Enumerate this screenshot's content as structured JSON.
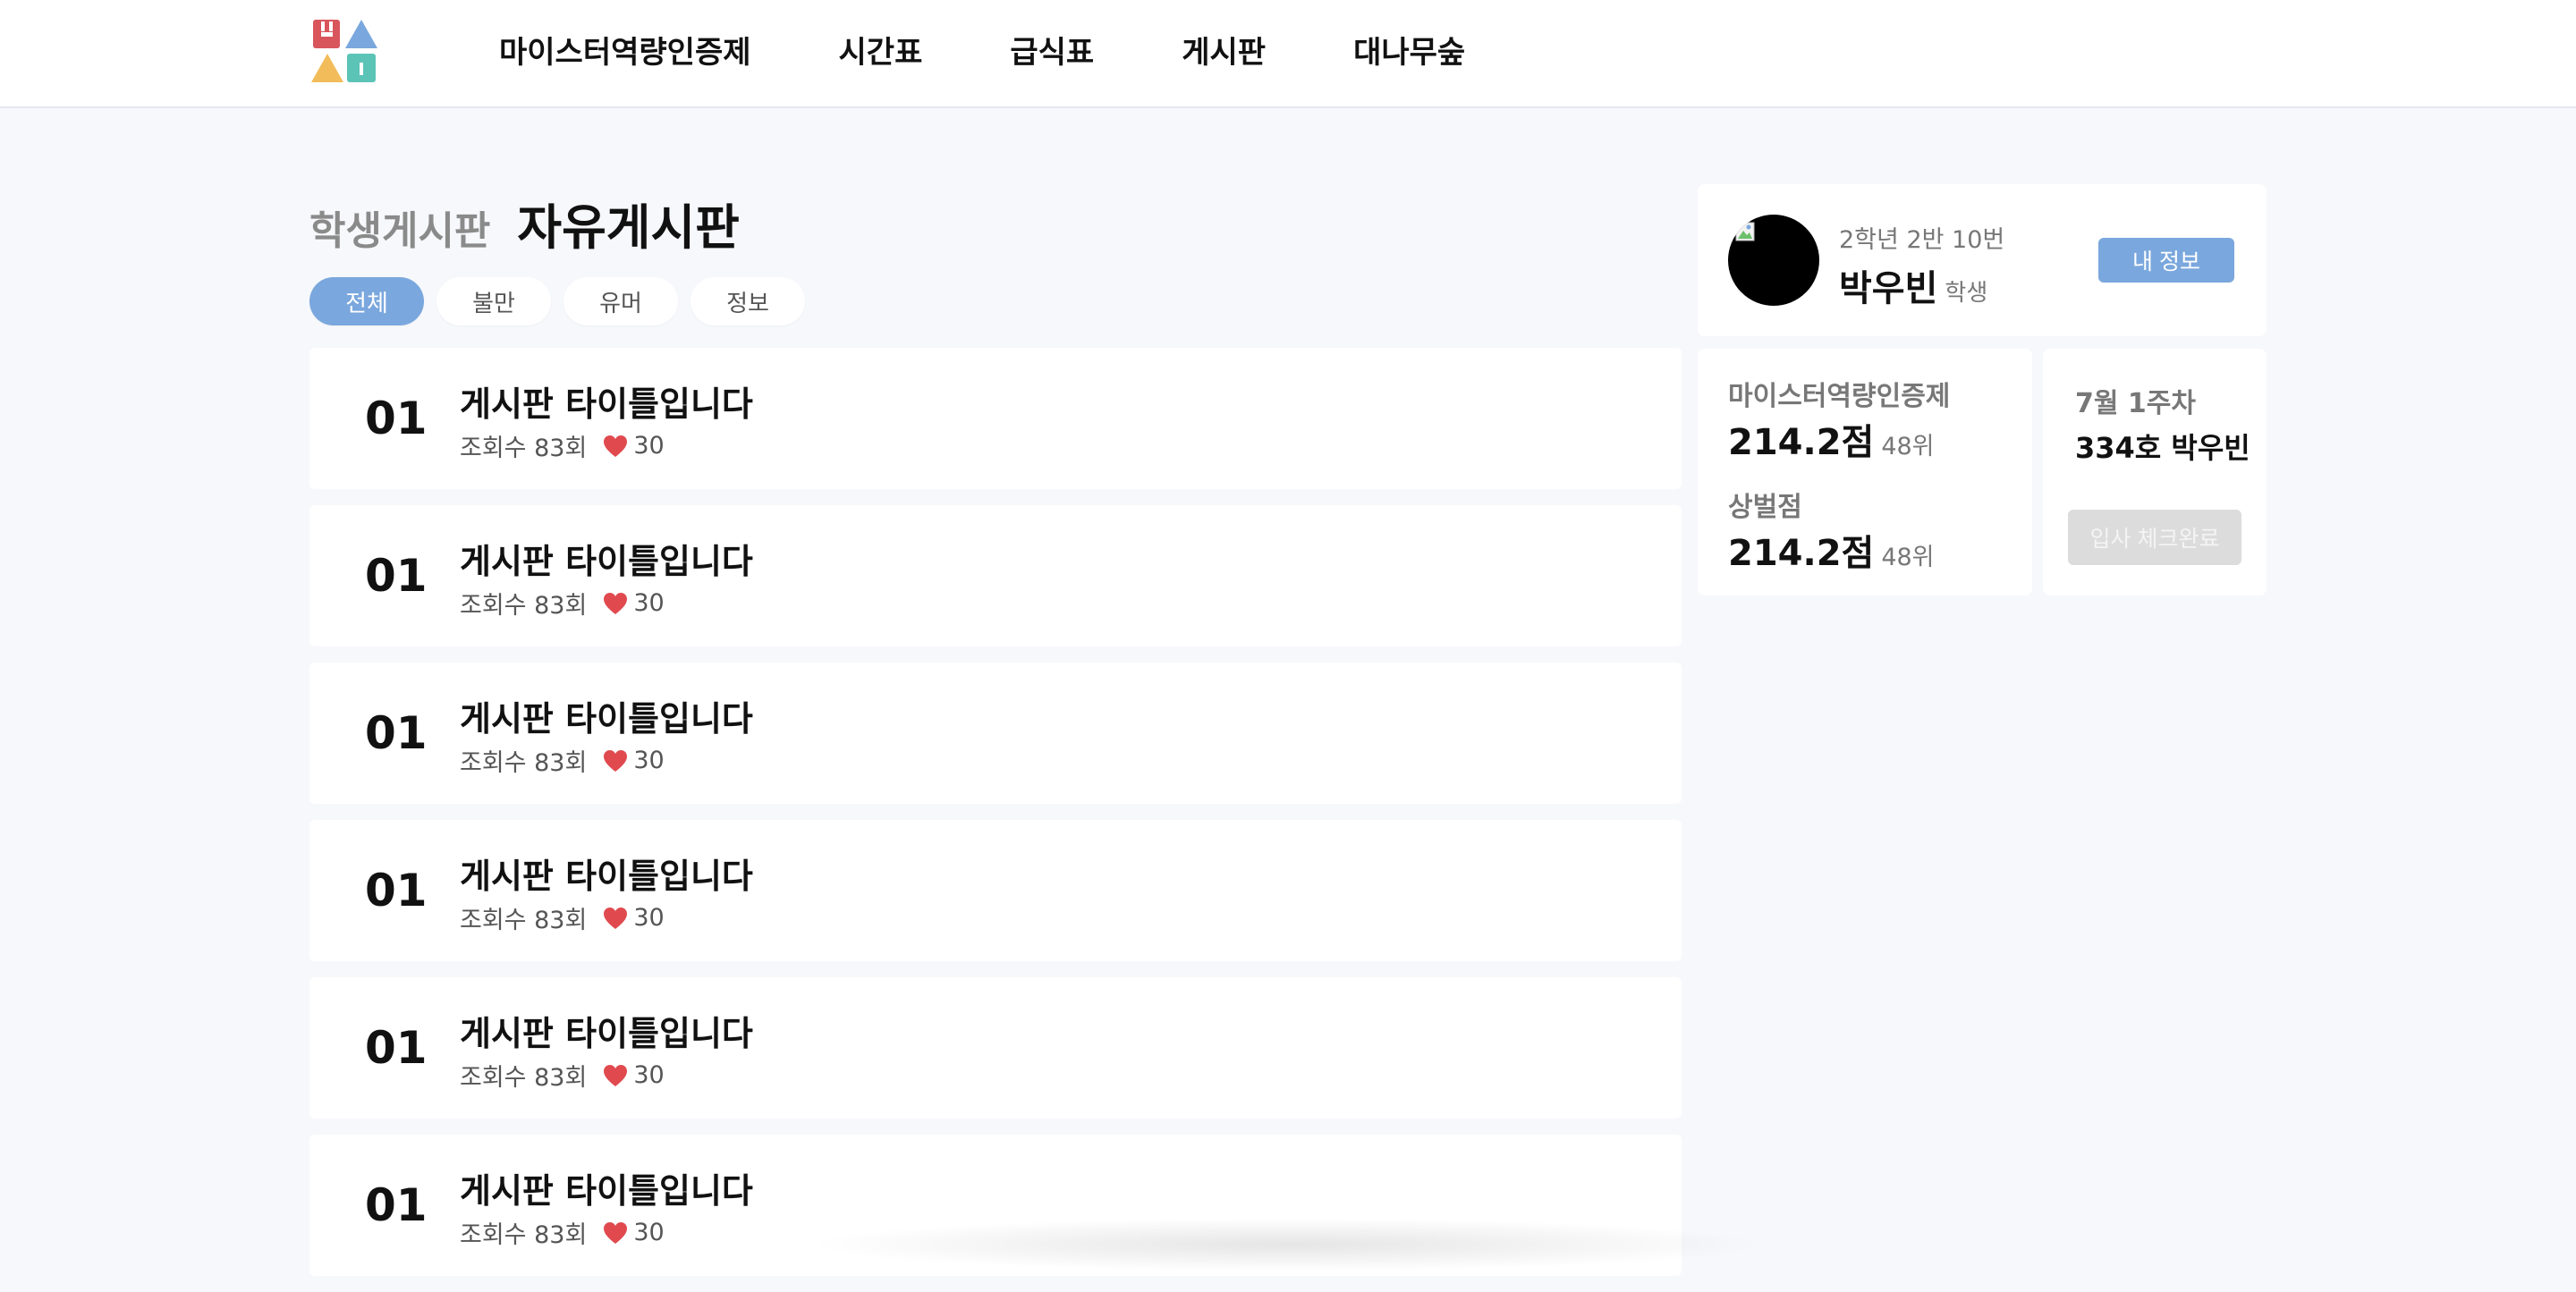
{
  "header": {
    "logo_icon": "house-blocks-icon",
    "nav": [
      {
        "label": "마이스터역량인증제"
      },
      {
        "label": "시간표"
      },
      {
        "label": "급식표"
      },
      {
        "label": "게시판"
      },
      {
        "label": "대나무숲"
      }
    ]
  },
  "board": {
    "parent": "학생게시판",
    "name": "자유게시판"
  },
  "filters": [
    {
      "label": "전체",
      "active": true
    },
    {
      "label": "불만",
      "active": false
    },
    {
      "label": "유머",
      "active": false
    },
    {
      "label": "정보",
      "active": false
    }
  ],
  "posts": [
    {
      "num": "01",
      "title": "게시판 타이틀입니다",
      "views": "조회수 83회",
      "likes": "30"
    },
    {
      "num": "01",
      "title": "게시판 타이틀입니다",
      "views": "조회수 83회",
      "likes": "30"
    },
    {
      "num": "01",
      "title": "게시판 타이틀입니다",
      "views": "조회수 83회",
      "likes": "30"
    },
    {
      "num": "01",
      "title": "게시판 타이틀입니다",
      "views": "조회수 83회",
      "likes": "30"
    },
    {
      "num": "01",
      "title": "게시판 타이틀입니다",
      "views": "조회수 83회",
      "likes": "30"
    },
    {
      "num": "01",
      "title": "게시판 타이틀입니다",
      "views": "조회수 83회",
      "likes": "30"
    }
  ],
  "profile": {
    "class_info": "2학년 2반 10번",
    "name": "박우빈",
    "role": "학생",
    "my_info_label": "내 정보"
  },
  "scores": {
    "meister_label": "마이스터역량인증제",
    "meister_value": "214.2점",
    "meister_rank": "48위",
    "merit_label": "상벌점",
    "merit_value": "214.2점",
    "merit_rank": "48위"
  },
  "dorm": {
    "week": "7월 1주차",
    "room": "334호 박우빈",
    "checkin_label": "입사 체크완료"
  },
  "colors": {
    "accent": "#7aa7dd",
    "heart": "#e04a4f",
    "background": "#f7f8fc",
    "disabled": "#dcdcdc"
  }
}
